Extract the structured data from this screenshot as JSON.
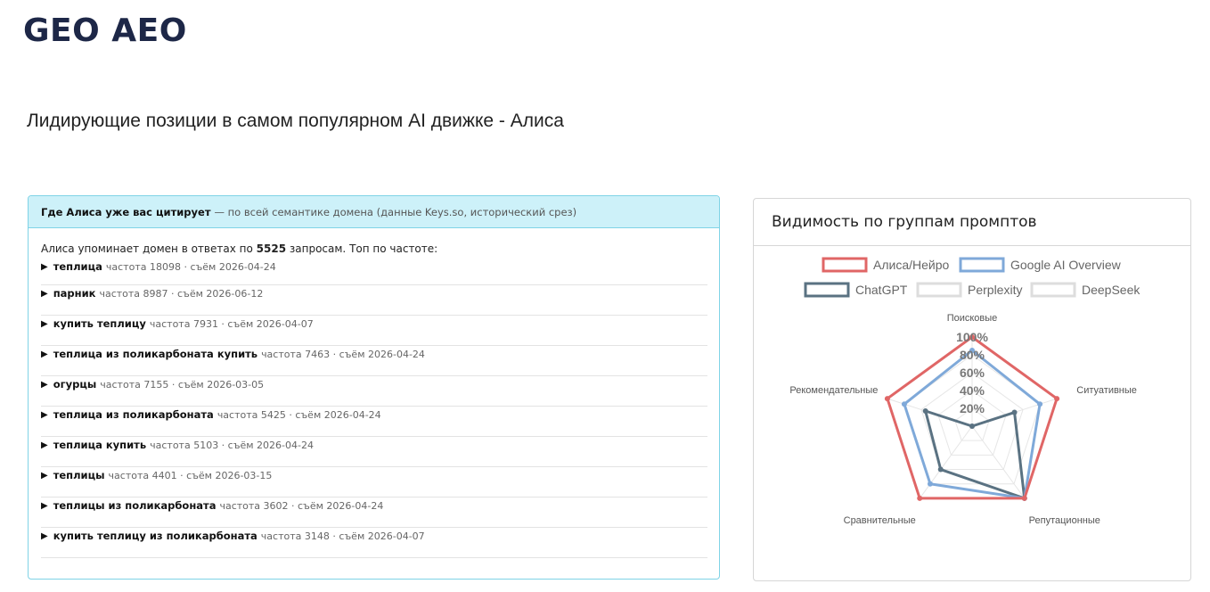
{
  "header": {
    "logo_text": "GEO AEO",
    "subtitle": "Лидирующие позиции в самом популярном AI движке - Алиса"
  },
  "citations": {
    "title_bold": "Где Алиса уже вас цитирует",
    "title_note": "— по всей семантике домена (данные Keys.so, исторический срез)",
    "intro_before": "Алиса упоминает домен в ответах по",
    "intro_count": "5525",
    "intro_after": "запросам. Топ по частоте:",
    "freq_label": "частота",
    "date_label": "съём",
    "items": [
      {
        "query": "теплица",
        "freq": "18098",
        "date": "2026-04-24"
      },
      {
        "query": "парник",
        "freq": "8987",
        "date": "2026-06-12"
      },
      {
        "query": "купить теплицу",
        "freq": "7931",
        "date": "2026-04-07"
      },
      {
        "query": "теплица из поликарбоната купить",
        "freq": "7463",
        "date": "2026-04-24"
      },
      {
        "query": "огурцы",
        "freq": "7155",
        "date": "2026-03-05"
      },
      {
        "query": "теплица из поликарбоната",
        "freq": "5425",
        "date": "2026-04-24"
      },
      {
        "query": "теплица купить",
        "freq": "5103",
        "date": "2026-04-24"
      },
      {
        "query": "теплицы",
        "freq": "4401",
        "date": "2026-03-15"
      },
      {
        "query": "теплицы из поликарбоната",
        "freq": "3602",
        "date": "2026-04-24"
      },
      {
        "query": "купить теплицу из поликарбоната",
        "freq": "3148",
        "date": "2026-04-07"
      }
    ]
  },
  "visibility": {
    "title": "Видимость по группам промптов",
    "chart_data": {
      "type": "radar",
      "categories": [
        "Поисковые",
        "Ситуативные",
        "Репутационные",
        "Сравнительные",
        "Рекомендательные"
      ],
      "r_ticks": [
        "20%",
        "40%",
        "60%",
        "80%",
        "100%"
      ],
      "rlim": [
        0,
        100
      ],
      "legend_position": "top",
      "series": [
        {
          "name": "Алиса/Нейро",
          "color": "#e06666",
          "values": [
            100,
            100,
            100,
            100,
            100
          ]
        },
        {
          "name": "Google AI Overview",
          "color": "#7fa9d9",
          "values": [
            85,
            80,
            100,
            80,
            80
          ]
        },
        {
          "name": "ChatGPT",
          "color": "#5a7282",
          "values": [
            0,
            50,
            100,
            60,
            55
          ]
        },
        {
          "name": "Perplexity",
          "color": "#dddddd",
          "values": [
            0,
            0,
            0,
            0,
            0
          ]
        },
        {
          "name": "DeepSeek",
          "color": "#dddddd",
          "values": [
            0,
            0,
            0,
            0,
            0
          ]
        }
      ]
    }
  }
}
